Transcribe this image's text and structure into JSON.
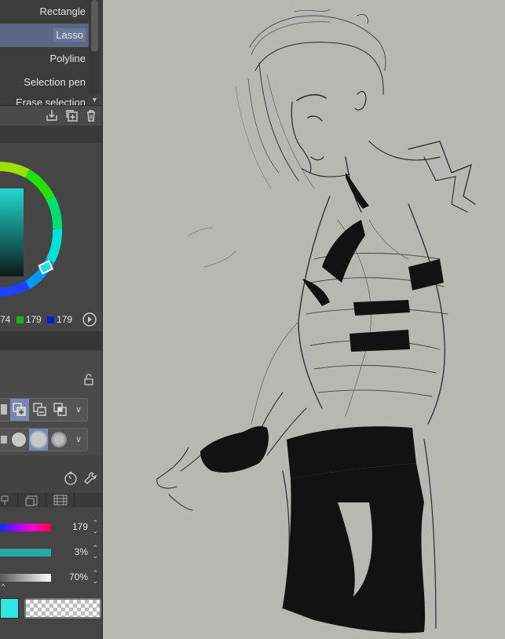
{
  "tools": {
    "items": [
      {
        "label": "Rectangle"
      },
      {
        "label": "Lasso"
      },
      {
        "label": "Polyline"
      },
      {
        "label": "Selection pen"
      },
      {
        "label": "Erase selection"
      }
    ],
    "selected": "Lasso"
  },
  "color": {
    "rgb_r": "74",
    "rgb_g": "179",
    "rgb_b": "179",
    "hue_value": "179",
    "saturation_value": "3%",
    "brightness_value": "70%",
    "main_color": "#2ee6e0",
    "accent": "#5b6785"
  }
}
